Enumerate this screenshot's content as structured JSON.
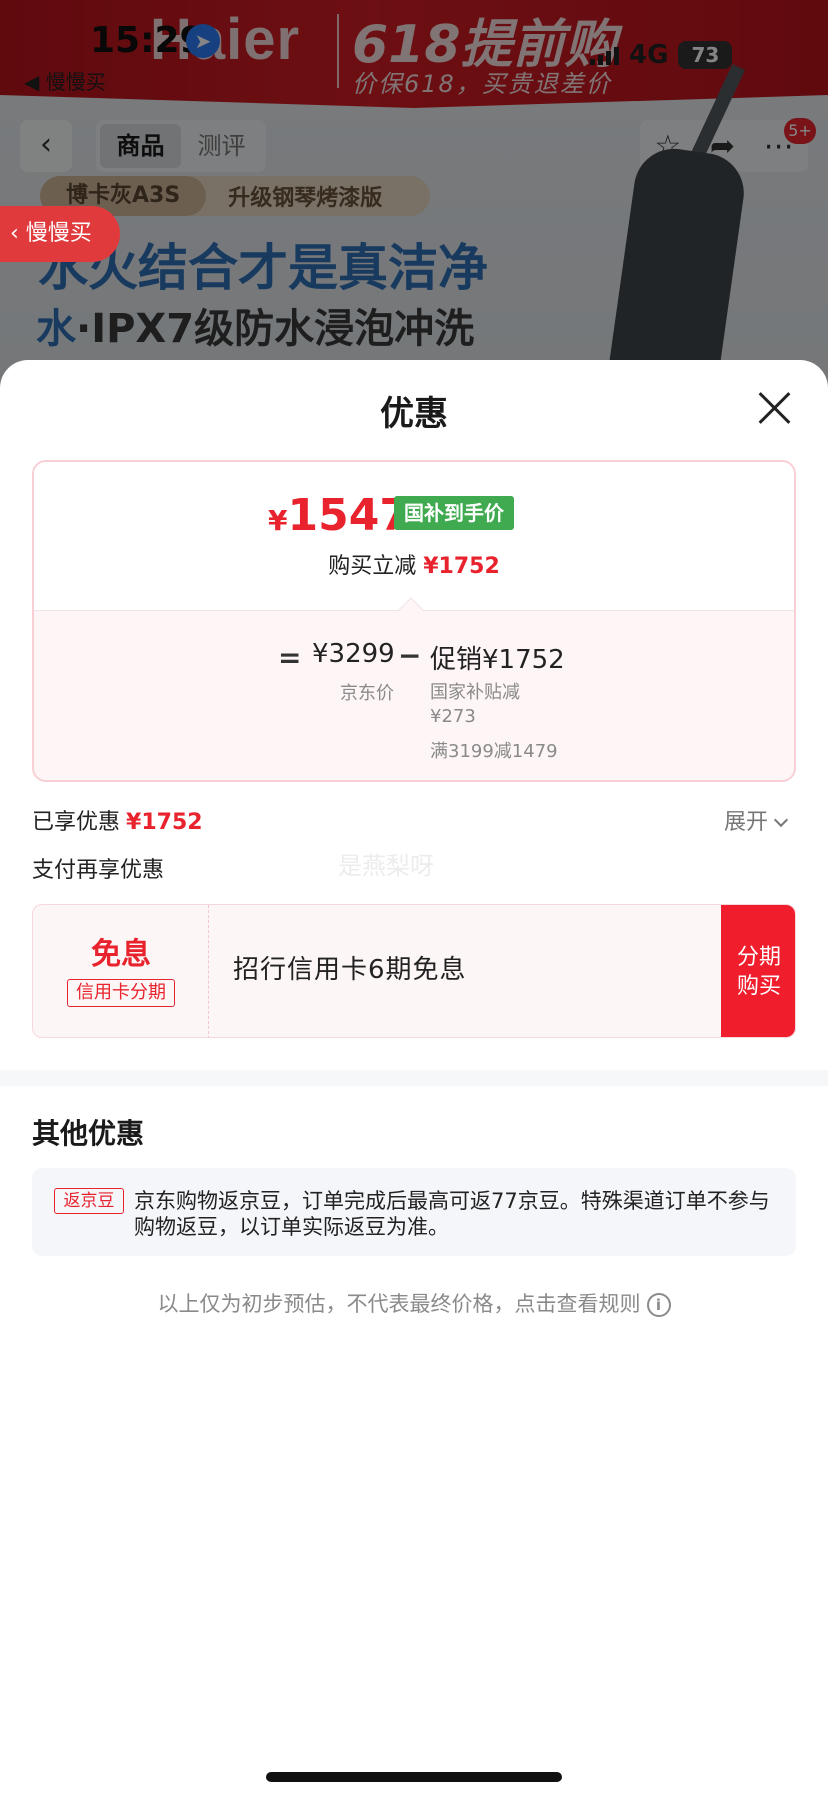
{
  "status_bar": {
    "time": "15:29",
    "network": "4G",
    "battery": "73",
    "back_app": "◀ 慢慢买"
  },
  "banner": {
    "brand": "Haier",
    "title": "618提前购",
    "subtitle": "价保618，买贵退差价"
  },
  "product_nav": {
    "tabs": [
      "商品",
      "测评"
    ],
    "active_tab": "商品",
    "more_badge": "5+"
  },
  "product": {
    "spec_active": "博卡灰A3S",
    "spec_other": "升级钢琴烤漆版",
    "slogan_line1": "水火结合才是真洁净",
    "slogan_line2_prefix": "水",
    "slogan_line2_rest": "·IPX7级防水浸泡冲洗"
  },
  "float_button": {
    "label": "慢慢买"
  },
  "sheet": {
    "title": "优惠",
    "price_summary": {
      "currency": "¥",
      "final_price": "1547",
      "gov_tag": "国补到手价",
      "reduce_label": "购买立减",
      "reduce_value": "¥1752",
      "equals": "=",
      "jd_price": "¥3299",
      "jd_label": "京东价",
      "minus": "−",
      "promo_price": "促销¥1752",
      "gov_subsidy_label": "国家补贴减",
      "gov_subsidy_value": "¥273",
      "full_reduce": "满3199减1479"
    },
    "enjoyed": {
      "label": "已享优惠",
      "value": "¥1752",
      "expand": "展开"
    },
    "pay_more_label": "支付再享优惠",
    "watermark": "是燕梨呀",
    "installment": {
      "title": "免息",
      "tag": "信用卡分期",
      "text": "招行信用卡6期免息",
      "button": "分期购买"
    },
    "other_title": "其他优惠",
    "bean": {
      "tag": "返京豆",
      "text": "京东购物返京豆，订单完成后最高可返77京豆。特殊渠道订单不参与购物返豆，以订单实际返豆为准。"
    },
    "rules_text": "以上仅为初步预估，不代表最终价格，点击查看规则"
  },
  "colors": {
    "accent_red": "#e8232e",
    "gov_green": "#3faa4f",
    "button_red": "#f01e2c"
  }
}
